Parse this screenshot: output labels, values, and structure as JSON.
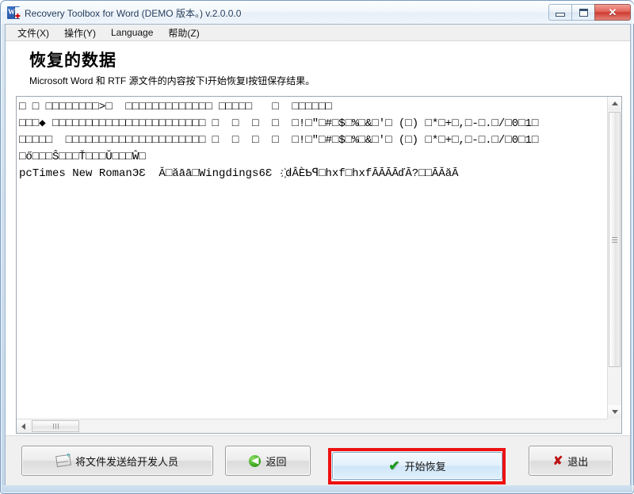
{
  "window": {
    "title": "Recovery Toolbox for Word (DEMO 版本。) v.2.0.0.0",
    "icon": "word-document-icon",
    "controls": {
      "minimize": "–",
      "maximize": "❐",
      "close": "✕"
    }
  },
  "menubar": {
    "items": [
      {
        "label": "文件(X)",
        "name": "menu-file"
      },
      {
        "label": "操作(Y)",
        "name": "menu-actions"
      },
      {
        "label": "Language",
        "name": "menu-language"
      },
      {
        "label": "帮助(Z)",
        "name": "menu-help"
      }
    ]
  },
  "page": {
    "title": "恢复的数据",
    "subtitle": "Microsoft Word 和 RTF 源文件的内容按下I开始恢复I按钮保存结果。"
  },
  "textview": {
    "lines": [
      "□ □ □□□□□□□□>□  □□□□□□□□□□□□□ □□□□□   □  □□□□□□",
      "□□□◆ □□□□□□□□□□□□□□□□□□□□□□□ □  □  □  □  □!□\"□#□$□%□&□'□ (□) □*□+□,□-□.□/□0□1□",
      "□□□□□  □□□□□□□□□□□□□□□□□□□□□ □  □  □  □  □!□\"□#□$□%□&□'□ (□) □*□+□,□-□.□/□0□1□",
      "□ő□□□Ŝ□□□Ť□□□Ŭ□□□Ŵ□",
      "pcTimes New RomanЭƐ  Ă□ăāā□Wingdings6Ɛ  ҉ԁÂÈƄꟼ□hxf□hxfĀĀĀĀďĀ?□□ĀĂăĀ"
    ]
  },
  "scrollbars": {
    "vertical": {
      "up_arrow": "▲",
      "down_arrow": "▼",
      "thumb_grip": "grip"
    },
    "horizontal": {
      "left_arrow": "◀",
      "right_arrow": "▶",
      "thumb_grip": "grip"
    }
  },
  "buttons": {
    "send": {
      "label": "将文件发送给开发人员",
      "icon": "envelope-send-icon"
    },
    "back": {
      "label": "返回",
      "icon": "green-back-arrow-icon"
    },
    "start": {
      "label": "开始恢复",
      "icon": "green-check-icon"
    },
    "exit": {
      "label": "退出",
      "icon": "red-x-icon"
    }
  },
  "annotation": {
    "highlight_color": "#ee1111",
    "target": "start-recovery-button"
  },
  "colors": {
    "accent": "#2c5aa8",
    "highlight": "#ee1111",
    "check_green": "#1a9a1a",
    "exit_red": "#bb1111",
    "client_bg": "#f0f0f0"
  }
}
